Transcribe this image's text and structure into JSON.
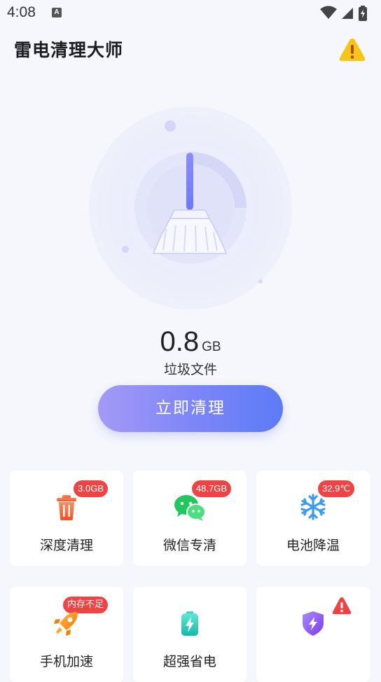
{
  "status_bar": {
    "time": "4:08",
    "notification_letter": "A"
  },
  "header": {
    "title": "雷电清理大师"
  },
  "scan": {
    "junk_value": "0.8",
    "junk_unit": "GB",
    "junk_label": "垃圾文件",
    "clean_button": "立即清理"
  },
  "features": [
    {
      "label": "深度清理",
      "badge": "3.0GB",
      "icon": "trash-icon"
    },
    {
      "label": "微信专清",
      "badge": "48.7GB",
      "icon": "wechat-icon"
    },
    {
      "label": "电池降温",
      "badge": "32.9℃",
      "icon": "snowflake-icon"
    },
    {
      "label": "手机加速",
      "badge": "内存不足",
      "icon": "rocket-icon"
    },
    {
      "label": "超强省电",
      "badge": "",
      "icon": "battery-icon"
    },
    {
      "label": "",
      "badge": "",
      "icon": "shield-icon"
    }
  ],
  "colors": {
    "accent_start": "#a49af7",
    "accent_end": "#5b7bf6",
    "badge_red": "#ef4444",
    "warning_yellow": "#f5c518"
  }
}
